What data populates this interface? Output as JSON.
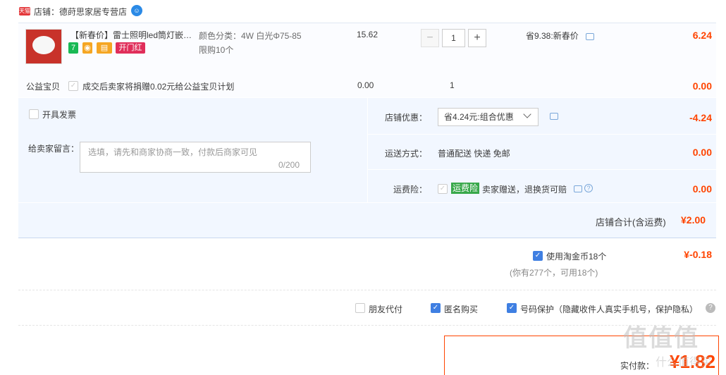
{
  "shop": {
    "badge": "天猫",
    "name": "店铺：德莳思家居专营店",
    "chat_icon_text": "☺"
  },
  "item": {
    "title": "【新春价】雷士照明led筒灯嵌入式...",
    "promos": [
      {
        "text": "7",
        "color": "#19b955"
      },
      {
        "text": "◉",
        "color": "#f5a623"
      },
      {
        "text": "▤",
        "color": "#f5a623"
      },
      {
        "text": "开门红",
        "color": "#e02e5a"
      }
    ],
    "sku": "颜色分类：4W 白光&Phi;75-85",
    "limit": "限购10个",
    "unit_price": "15.62",
    "quantity": "1",
    "qty_minus": "−",
    "qty_plus": "+",
    "saving": "省9.38:新春价",
    "subtotal": "6.24"
  },
  "charity": {
    "label": "公益宝贝",
    "text": "成交后卖家将捐赠0.02元给公益宝贝计划",
    "price": "0.00",
    "qty": "1",
    "subtotal": "0.00"
  },
  "panel": {
    "invoice_label": "开具发票",
    "note_label": "给卖家留言：",
    "note_placeholder": "选填，请先和商家协商一致，付款后商家可见",
    "note_count": "0/200",
    "coupon_label": "店铺优惠：",
    "coupon_value": "省4.24元:组合优惠",
    "coupon_amount": "-4.24",
    "shipping_label": "运送方式：",
    "shipping_value": "普通配送 快递 免邮",
    "shipping_amount": "0.00",
    "insurance_label": "运费险：",
    "insurance_tag": "运费险",
    "insurance_text": "卖家赠送，退换货可赔",
    "insurance_amount": "0.00",
    "total_label": "店铺合计(含运费)",
    "total_amount": "¥2.00"
  },
  "coins": {
    "label": "使用淘金币18个",
    "amount": "¥-0.18",
    "note": "(你有277个，可用18个)"
  },
  "options": {
    "friend_pay": "朋友代付",
    "anonymous": "匿名购买",
    "phone_protect": "号码保护（隐藏收件人真实手机号，保护隐私）",
    "help": "?"
  },
  "payment": {
    "label": "实付款：",
    "amount": "¥1.82"
  },
  "watermark": {
    "main": "值值值",
    "sub": "什么值得买"
  },
  "colors": {
    "accent": "#ff4400",
    "panel": "#f2f7ff",
    "check": "#3f7fe2"
  }
}
